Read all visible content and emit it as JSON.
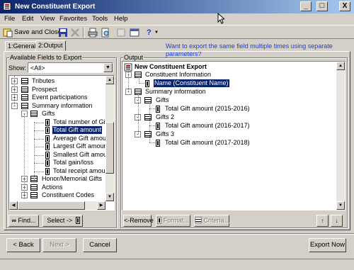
{
  "window": {
    "title": "New Constituent Export",
    "minimize": "_",
    "maximize": "□",
    "close": "X"
  },
  "menu": [
    "File",
    "Edit",
    "View",
    "Favorites",
    "Tools",
    "Help"
  ],
  "toolbar": {
    "save_close": "Save and Close",
    "help": "?"
  },
  "tabs": [
    {
      "label": "1:General"
    },
    {
      "label": "2:Output"
    }
  ],
  "hint_link": "Want to export the same field multiple times using separate parameters?",
  "available": {
    "title": "Available Fields to Export",
    "show_label": "Show:",
    "show_value": "<All>",
    "rows": [
      {
        "label": "Tributes",
        "kind": "table",
        "pm": "+"
      },
      {
        "label": "Prospect",
        "kind": "table",
        "pm": "+"
      },
      {
        "label": "Event participations",
        "kind": "table",
        "pm": "+"
      },
      {
        "label": "Summary information",
        "kind": "table",
        "pm": "-"
      },
      {
        "label": "Gifts",
        "kind": "table",
        "pm": "-"
      },
      {
        "label": "Total number of Gifts",
        "kind": "field"
      },
      {
        "label": "Total Gift amount",
        "kind": "field",
        "selected": true
      },
      {
        "label": "Average Gift amount",
        "kind": "field"
      },
      {
        "label": "Largest Gift amount",
        "kind": "field"
      },
      {
        "label": "Smallest Gift amount",
        "kind": "field"
      },
      {
        "label": "Total gain/loss",
        "kind": "field"
      },
      {
        "label": "Total receipt amount",
        "kind": "field"
      },
      {
        "label": "Honor/Memorial Gifts",
        "kind": "table",
        "pm": "+"
      },
      {
        "label": "Actions",
        "kind": "table",
        "pm": "+"
      },
      {
        "label": "Constituent Codes",
        "kind": "table",
        "pm": "+"
      }
    ],
    "find_button": "Find...",
    "select_button": "Select ->"
  },
  "output": {
    "title": "Output",
    "root": "New Constituent Export",
    "rows": [
      {
        "label": "Constituent Information",
        "kind": "table",
        "pm": "-"
      },
      {
        "label": "Name (Constituent Name)",
        "kind": "field",
        "selected": true
      },
      {
        "label": "Summary information",
        "kind": "table",
        "pm": "-"
      },
      {
        "label": "Gifts",
        "kind": "table",
        "pm": "-"
      },
      {
        "label": "Total Gift amount (2015-2016)",
        "kind": "field"
      },
      {
        "label": "Gifts 2",
        "kind": "table",
        "pm": "-"
      },
      {
        "label": "Total Gift amount (2016-2017)",
        "kind": "field"
      },
      {
        "label": "Gifts 3",
        "kind": "table",
        "pm": "-"
      },
      {
        "label": "Total Gift amount (2017-2018)",
        "kind": "field"
      }
    ],
    "remove_button": "<-Remove",
    "format_button": "Format...",
    "criteria_button": "Criteria..."
  },
  "footer": {
    "back": "< Back",
    "next": "Next >",
    "cancel": "Cancel",
    "export_now": "Export Now"
  },
  "colors": {
    "titlebar": "#0a246a",
    "selection": "#0a246a",
    "link": "#1b3de0"
  }
}
